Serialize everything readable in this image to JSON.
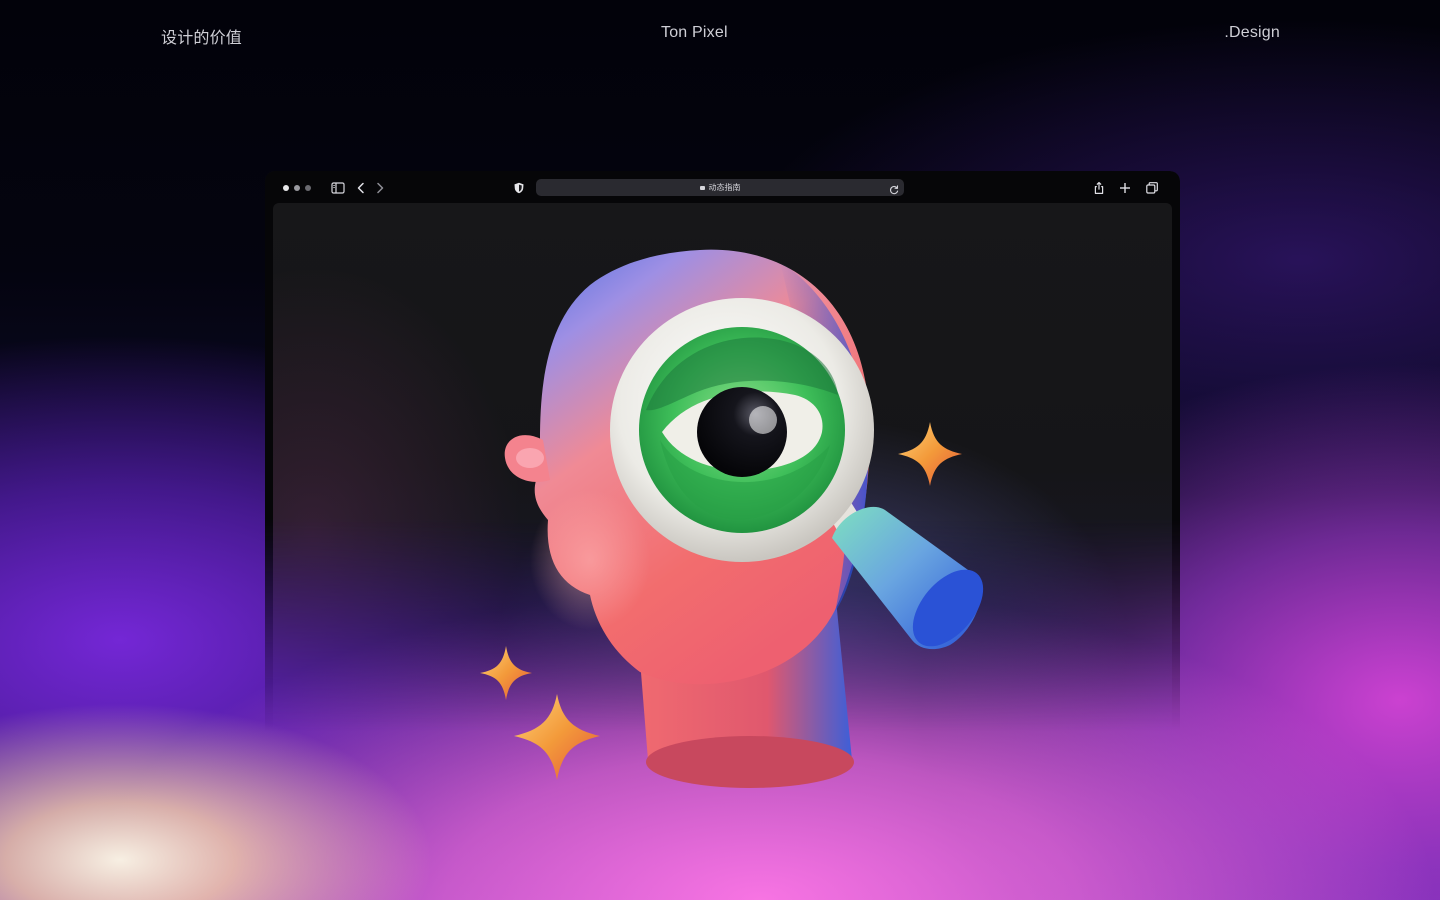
{
  "header": {
    "left": "设计的价值",
    "center": "Ton Pixel",
    "right": ".Design"
  },
  "browser": {
    "url": "动态指南",
    "window_dots": [
      "#e8e8ea",
      "#9a9aa0",
      "#6a6a70"
    ]
  },
  "artwork": {
    "subject": "3d-head-with-magnifying-glass",
    "colors": {
      "head_top": "#3f6fe0",
      "head_face": "#f07a80",
      "lens_ring": "#ecebe6",
      "iris": "#3fbf5a",
      "pupil": "#0b0b10",
      "handle": "#2f5fe0",
      "sparkle": "#f2a23a"
    }
  }
}
